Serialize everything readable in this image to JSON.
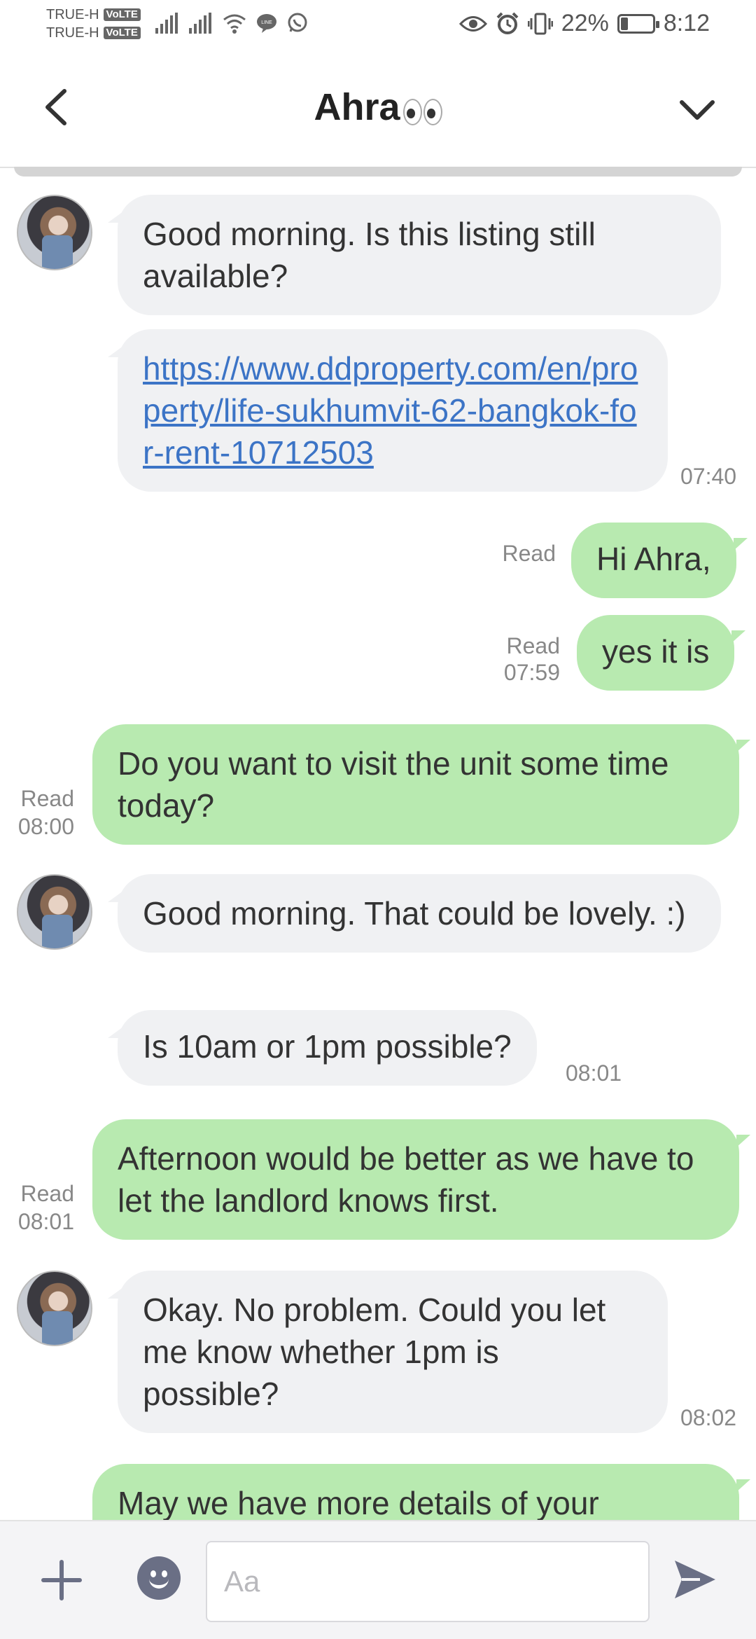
{
  "status_bar": {
    "carrier_1": "TRUE-H",
    "carrier_2": "TRUE-H",
    "volte_badge": "VoLTE",
    "battery_percent": "22%",
    "battery_level": 0.22,
    "time": "8:12",
    "icons": [
      "signal-icon",
      "signal-icon",
      "wifi-icon",
      "line-icon",
      "whatsapp-icon",
      "eye-icon",
      "alarm-icon",
      "vibrate-icon",
      "battery-icon"
    ]
  },
  "header": {
    "title": "Ahra",
    "title_emoji": "eyes-emoji",
    "back_icon": "chevron-left-icon",
    "collapse_icon": "chevron-down-icon"
  },
  "messages": [
    {
      "side": "in",
      "text": "Good morning. Is this listing still available?",
      "avatar": true
    },
    {
      "side": "in",
      "text": "https://www.ddproperty.com/en/property/life-sukhumvit-62-bangkok-for-rent-10712503",
      "is_link": true,
      "time": "07:40"
    },
    {
      "side": "out",
      "text": "Hi Ahra,",
      "status": "Read"
    },
    {
      "side": "out",
      "text": "yes it is",
      "status": "Read",
      "time": "07:59"
    },
    {
      "side": "out",
      "text": "Do you want to visit the unit some time today?",
      "status": "Read",
      "time": "08:00"
    },
    {
      "side": "in",
      "text": "Good morning. That could be lovely. :)",
      "avatar": true
    },
    {
      "side": "in",
      "text": "Is 10am or 1pm possible?",
      "time": "08:01"
    },
    {
      "side": "out",
      "text": "Afternoon would be better as we have to let the landlord knows first.",
      "status": "Read",
      "time": "08:01"
    },
    {
      "side": "in",
      "text": "Okay. No problem. Could you let me know whether 1pm is possible?",
      "avatar": true,
      "time": "08:02"
    },
    {
      "side": "out",
      "text": "May we have more details of your",
      "partial": true
    }
  ],
  "input_bar": {
    "placeholder": "Aa",
    "value": "",
    "plus_icon": "plus-icon",
    "emoji_icon": "emoji-icon",
    "send_icon": "send-icon"
  },
  "colors": {
    "incoming_bubble": "#f0f1f3",
    "outgoing_bubble": "#b8eab0",
    "link": "#3c74c6",
    "meta_text": "#888888",
    "icon_gray": "#6a6f85"
  }
}
